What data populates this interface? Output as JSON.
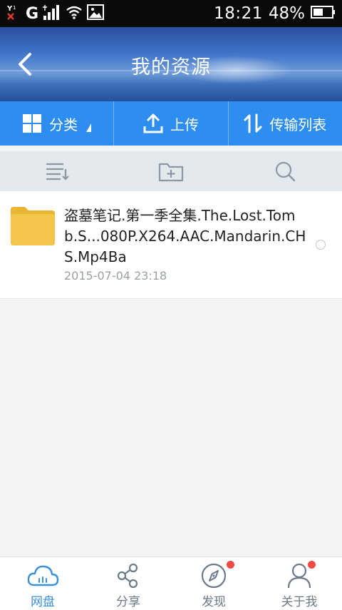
{
  "status_bar": {
    "time": "18:21",
    "battery_percent": "48%",
    "network": "G",
    "icons": [
      "no-sim-icon",
      "network-g-icon",
      "signal-icon",
      "wifi-icon",
      "image-notification-icon",
      "battery-icon"
    ]
  },
  "header": {
    "title": "我的资源",
    "back_icon": "chevron-left-icon"
  },
  "actions": [
    {
      "label": "分类",
      "icon": "grid-icon",
      "has_dropdown": true
    },
    {
      "label": "上传",
      "icon": "upload-icon"
    },
    {
      "label": "传输列表",
      "icon": "transfer-icon"
    }
  ],
  "toolbar": {
    "icons": [
      "sort-list-icon",
      "new-folder-icon",
      "search-icon"
    ]
  },
  "files": [
    {
      "name": "盗墓笔记.第一季全集.The.Lost.Tomb.S...080P.X264.AAC.Mandarin.CHS.Mp4Ba",
      "date": "2015-07-04  23:18",
      "type": "folder",
      "selected": false
    }
  ],
  "bottom_nav": [
    {
      "label": "网盘",
      "icon": "cloud-icon",
      "active": true,
      "badge": false
    },
    {
      "label": "分享",
      "icon": "share-icon",
      "active": false,
      "badge": false
    },
    {
      "label": "发现",
      "icon": "compass-icon",
      "active": false,
      "badge": true
    },
    {
      "label": "关于我",
      "icon": "user-icon",
      "active": false,
      "badge": true
    }
  ],
  "colors": {
    "accent": "#2d8ef0",
    "active_nav": "#3a8fd9",
    "badge": "#f04a43",
    "folder": "#f3c54a"
  }
}
